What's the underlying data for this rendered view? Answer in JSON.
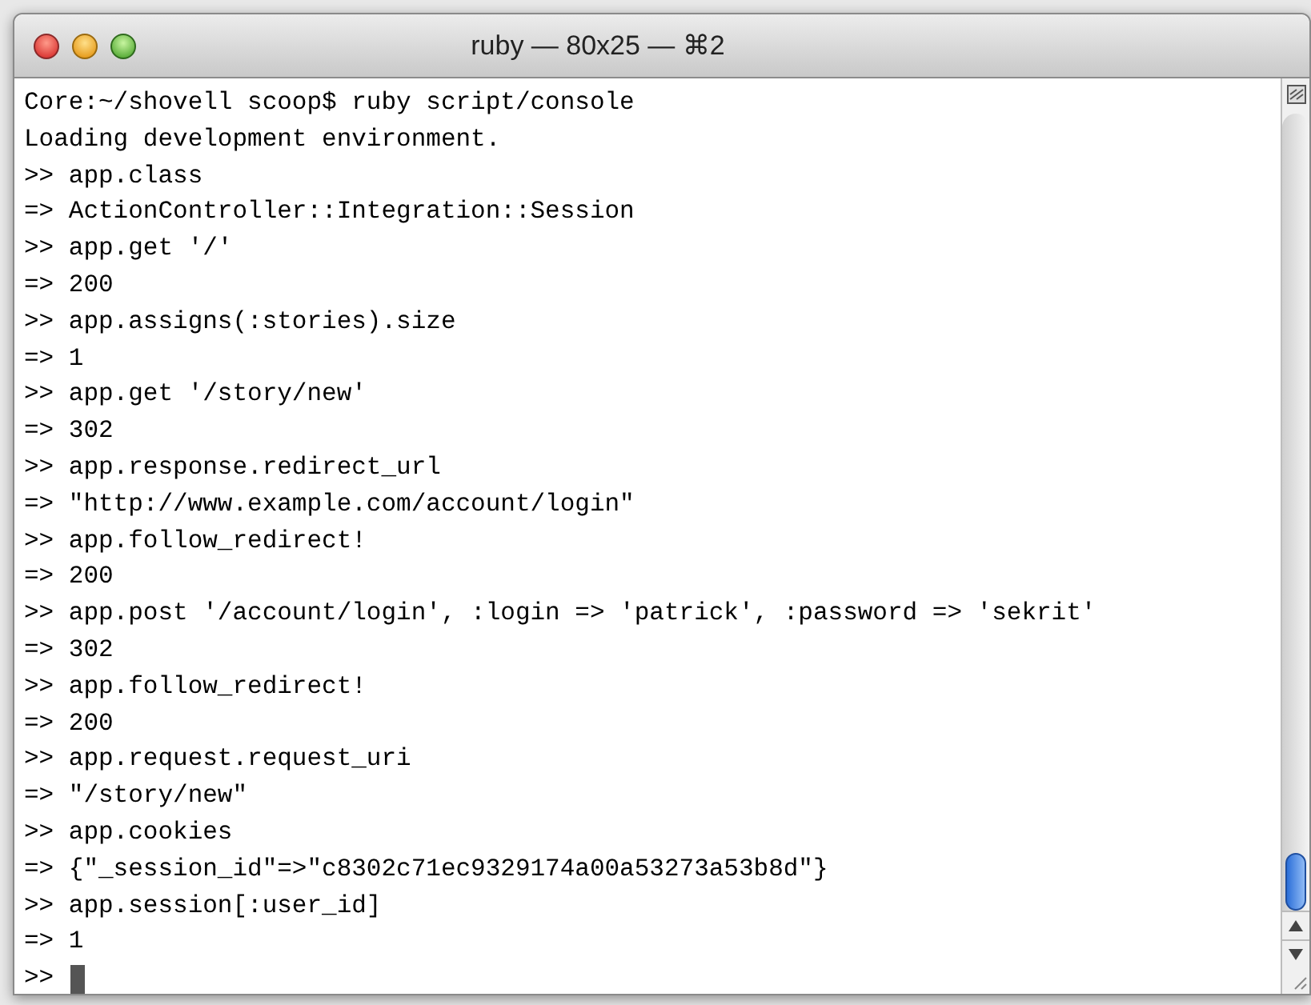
{
  "window": {
    "title": "ruby — 80x25 — ⌘2"
  },
  "terminal": {
    "lines": [
      "Core:~/shovell scoop$ ruby script/console",
      "Loading development environment.",
      ">> app.class",
      "=> ActionController::Integration::Session",
      ">> app.get '/'",
      "=> 200",
      ">> app.assigns(:stories).size",
      "=> 1",
      ">> app.get '/story/new'",
      "=> 302",
      ">> app.response.redirect_url",
      "=> \"http://www.example.com/account/login\"",
      ">> app.follow_redirect!",
      "=> 200",
      ">> app.post '/account/login', :login => 'patrick', :password => 'sekrit'",
      "=> 302",
      ">> app.follow_redirect!",
      "=> 200",
      ">> app.request.request_uri",
      "=> \"/story/new\"",
      ">> app.cookies",
      "=> {\"_session_id\"=>\"c8302c71ec9329174a00a53273a53b8d\"}",
      ">> app.session[:user_id]",
      "=> 1",
      ">>"
    ],
    "cursor": true
  }
}
